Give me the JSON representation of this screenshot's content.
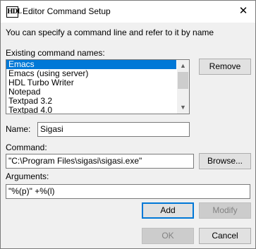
{
  "window": {
    "title": "Editor Command Setup",
    "icon_text": "HDL",
    "close_glyph": "✕"
  },
  "intro_text": "You can specify a command line and refer to it by name",
  "existing": {
    "label": "Existing command names:",
    "items": [
      "Emacs",
      "Emacs (using server)",
      "HDL Turbo Writer",
      "Notepad",
      "Textpad 3.2",
      "Textpad 4.0"
    ],
    "selected_index": 0,
    "scroll_up_glyph": "▲",
    "scroll_down_glyph": "▼"
  },
  "remove_label": "Remove",
  "name": {
    "label": "Name:",
    "value": "Sigasi"
  },
  "command": {
    "label": "Command:",
    "value": "\"C:\\Program Files\\sigasi\\sigasi.exe\""
  },
  "browse_label": "Browse...",
  "arguments": {
    "label": "Arguments:",
    "value": "\"%(p)\" +%(l)"
  },
  "add_label": "Add",
  "modify_label": "Modify",
  "ok_label": "OK",
  "cancel_label": "Cancel",
  "colors": {
    "selection": "#0078d7",
    "dialog_bg": "#f0f0f0",
    "focus_border": "#0078d7"
  }
}
